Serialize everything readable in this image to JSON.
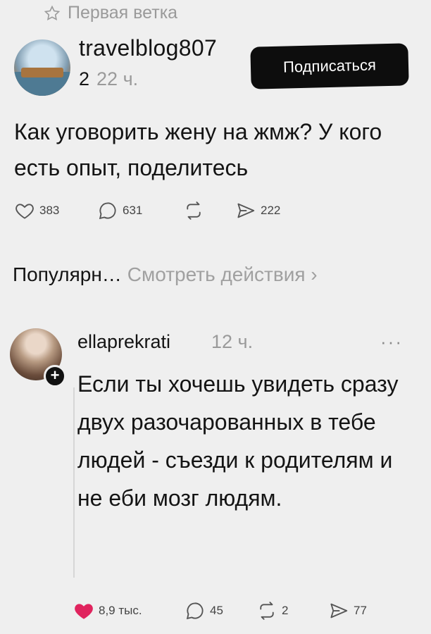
{
  "thread": {
    "label": "Первая ветка"
  },
  "post": {
    "username": "travelblog807",
    "badge_number": "2",
    "time": "22 ч.",
    "follow_label": "Подписаться",
    "text": "Как уговорить жену на жмж? У кого есть опыт, поделитесь",
    "stats": {
      "likes": "383",
      "comments": "631",
      "reposts": "",
      "shares": "222"
    }
  },
  "section": {
    "title": "Популярн…",
    "view_activity": "Смотреть действия"
  },
  "reply": {
    "username": "ellaprekrati",
    "time": "12 ч.",
    "more": "···",
    "text": "Если ты хочешь увидеть сразу двух разочарованных в тебе людей - съезди к родителям и не еби мозг людям.",
    "stats": {
      "likes": "8,9 тыс.",
      "comments": "45",
      "reposts": "2",
      "shares": "77"
    }
  },
  "colors": {
    "accent_like": "#e0245e",
    "button_bg": "#0d0d0d"
  }
}
